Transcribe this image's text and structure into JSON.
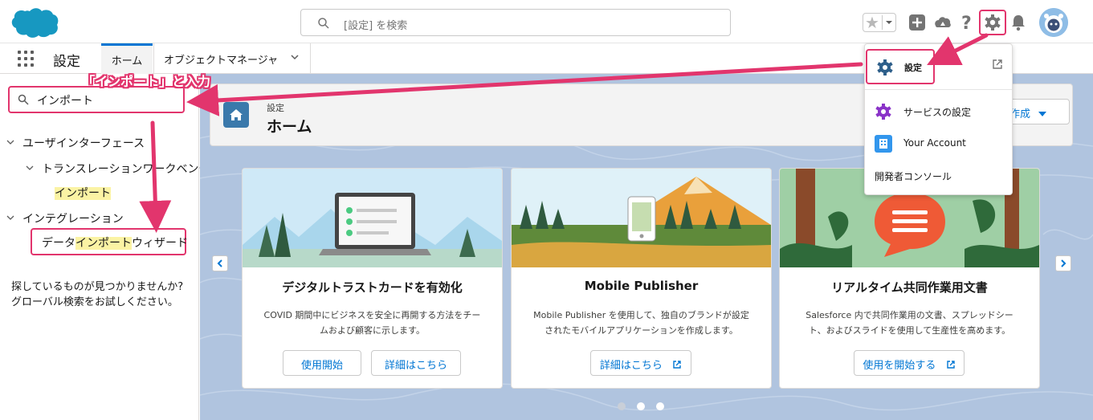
{
  "header": {
    "search_placeholder": "[設定] を検索"
  },
  "nav": {
    "app_name": "設定",
    "tabs": [
      {
        "label": "ホーム"
      },
      {
        "label": "オブジェクトマネージャ"
      }
    ]
  },
  "sidebar": {
    "quick_find_value": "インポート",
    "tree": [
      {
        "label": "ユーザインターフェース"
      },
      {
        "label": "トランスレーションワークベンチ"
      },
      {
        "label": "インポート"
      },
      {
        "label": "インテグレーション"
      },
      {
        "label_before": "データ",
        "label_hl": "インポート",
        "label_after": "ウィザード"
      }
    ],
    "not_found_line1": "探しているものが見つかりませんか?",
    "not_found_line2": "グローバル検索をお試しください。"
  },
  "page_header": {
    "subtitle": "設定",
    "title": "ホーム",
    "create_button": "作成"
  },
  "cards": [
    {
      "title": "デジタルトラストカードを有効化",
      "desc_line1": "COVID 期間中にビジネスを安全に再開する方法をチー",
      "desc_line2": "ムおよび顧客に示します。",
      "btn1": "使用開始",
      "btn2": "詳細はこちら"
    },
    {
      "title": "Mobile Publisher",
      "desc_line1": "Mobile Publisher を使用して、独自のブランドが設定",
      "desc_line2": "されたモバイルアプリケーションを作成します。",
      "btn1": "詳細はこちら"
    },
    {
      "title": "リアルタイム共同作業用文書",
      "desc_line1": "Salesforce 内で共同作業用の文書、スプレッドシー",
      "desc_line2": "ト、およびスライドを使用して生産性を高めます。",
      "btn1": "使用を開始する"
    }
  ],
  "setup_menu": {
    "setup": "設定",
    "service_setup": "サービスの設定",
    "your_account": "Your Account",
    "dev_console": "開発者コンソール"
  },
  "annotation": {
    "instruction": "「インポート」と入力"
  },
  "colors": {
    "accent": "#0176d3",
    "annotation": "#e2356d",
    "highlight": "#fbf3a4",
    "background": "#b0c4df"
  }
}
